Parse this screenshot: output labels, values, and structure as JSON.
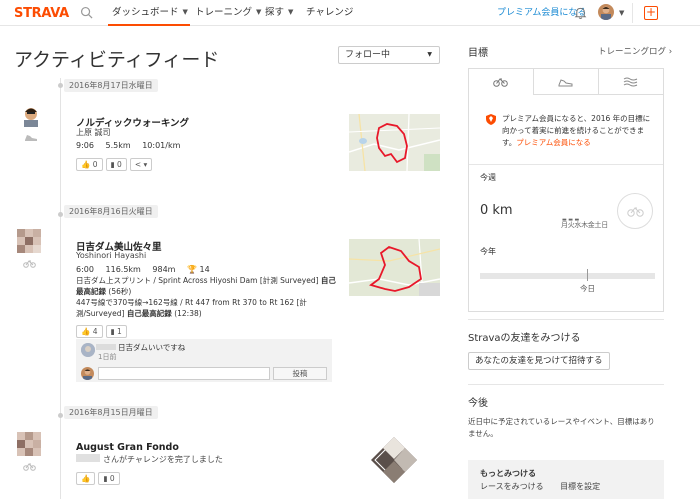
{
  "nav": {
    "logo": "STRAVA",
    "items": [
      {
        "label": "ダッシュボード",
        "active": true
      },
      {
        "label": "トレーニング",
        "active": false
      },
      {
        "label": "探す",
        "active": false
      },
      {
        "label": "チャレンジ",
        "active": false
      }
    ],
    "premium_link": "プレミアム会員になる",
    "icons": {
      "search": "search-icon",
      "bell": "bell-icon",
      "plus": "plus-icon"
    },
    "plus_label": "+"
  },
  "feed": {
    "title": "アクティビティフィード",
    "filter": {
      "selected": "フォロー中"
    },
    "dates": [
      "2016年8月17日水曜日",
      "2016年8月16日火曜日",
      "2016年8月15日月曜日"
    ],
    "activities": [
      {
        "title": "ノルディックウォーキング",
        "athlete": "上原 誠司",
        "stats": [
          "9:06",
          "5.5km",
          "10:01/km"
        ],
        "kudos": "0",
        "comments": "0"
      },
      {
        "title": "日吉ダム美山佐々里",
        "athlete": "Yoshinori Hayashi",
        "stats": [
          "6:00",
          "116.5km",
          "984m",
          "14"
        ],
        "segments": [
          {
            "text": "日吉ダム上スプリント / Sprint Across Hiyoshi Dam [計測 Surveyed]",
            "pr": "自己最高記録",
            "time": "(56秒)"
          },
          {
            "text": "447号線で370号線→162号線 / Rt 447 from Rt 370 to Rt 162 [計測/Surveyed]",
            "pr": "自己最高記録",
            "time": "(12:38)"
          }
        ],
        "kudos": "4",
        "comments": "1",
        "comment": {
          "text": "日吉ダムいいですね",
          "time": "1日前"
        },
        "post_label": "投稿"
      },
      {
        "title": "August Gran Fondo",
        "subtitle": "さんがチャレンジを完了しました",
        "kudos": "",
        "comments": "0"
      }
    ]
  },
  "sidebar": {
    "goals": {
      "title": "目標",
      "link": "トレーニングログ",
      "tabs": [
        "bike-icon",
        "shoe-icon",
        "swim-icon"
      ],
      "premium_note_prefix": "プレミアム会員になると、2016 年の目標に向かって着実に前進を続けることができます。",
      "premium_note_link": "プレミアム会員になる",
      "week_label": "今週",
      "week_value": "0 km",
      "week_days": "月火水木金土日",
      "year_label": "今年",
      "today_label": "今日"
    },
    "friends": {
      "title": "Stravaの友達をみつける",
      "invite": "あなたの友達を見つけて招待する"
    },
    "upcoming": {
      "title": "今後",
      "text": "近日中に予定されているレースやイベント、目標はありません。"
    },
    "more": {
      "title": "もっとみつける",
      "links": [
        "レースをみつける",
        "目標を設定"
      ]
    }
  },
  "colors": {
    "brand": "#fc4c02",
    "link": "#1a8ad3",
    "route": "#e8182a"
  }
}
